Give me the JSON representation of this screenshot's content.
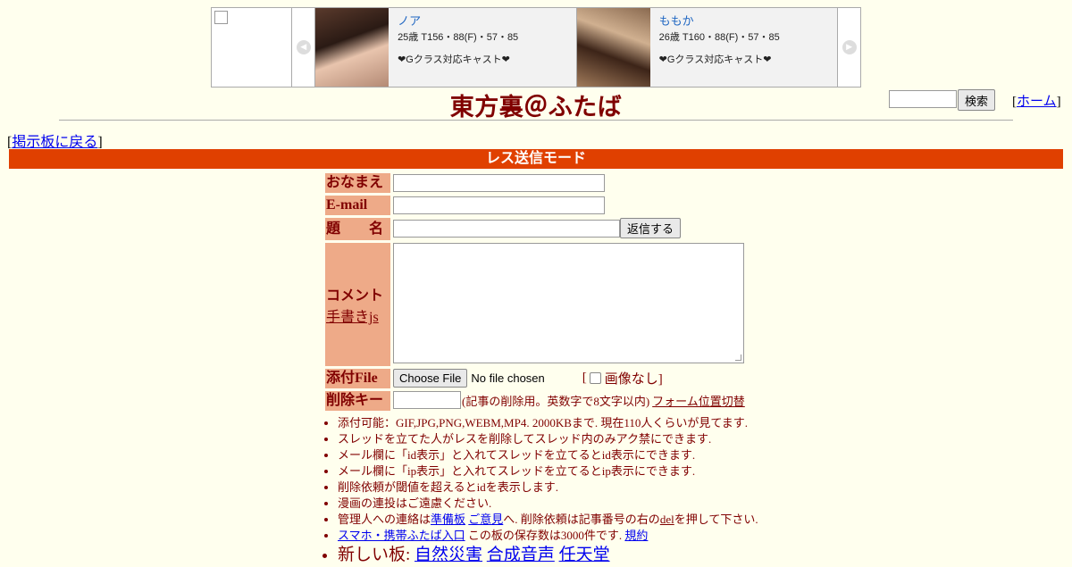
{
  "ad": {
    "casts": [
      {
        "name": "ノア",
        "stats": "25歳 T156・88(F)・57・85",
        "tag": "❤Gクラス対応キャスト❤"
      },
      {
        "name": "ももか",
        "stats": "26歳 T160・88(F)・57・85",
        "tag": "❤Gクラス対応キャスト❤"
      }
    ]
  },
  "header": {
    "title": "東方裏＠ふたば",
    "search_button": "検索",
    "home_open": "[",
    "home_label": "ホーム",
    "home_close": "]"
  },
  "nav": {
    "back_open": "[",
    "back_label": "掲示板に戻る",
    "back_close": "]"
  },
  "mode_title": "レス送信モード",
  "form": {
    "name_label": "おなまえ",
    "email_label": "E-mail",
    "subject_label": "題　　名",
    "submit_label": "返信する",
    "comment_label": "コメント",
    "handwrite_link": "手書きjs",
    "file_label": "添付File",
    "file_button": "Choose File",
    "file_status": "No file chosen",
    "noimage_open": "[",
    "noimage_label": "画像なし]",
    "delkey_label": "削除キー",
    "delkey_note": "(記事の削除用。英数字で8文字以内)",
    "form_toggle": "フォーム位置切替"
  },
  "rules": {
    "r1": "添付可能：GIF,JPG,PNG,WEBM,MP4. 2000KBまで. 現在110人くらいが見てます.",
    "r2": "スレッドを立てた人がレスを削除してスレッド内のみアク禁にできます.",
    "r3": "メール欄に「id表示」と入れてスレッドを立てるとid表示にできます.",
    "r4": "メール欄に「ip表示」と入れてスレッドを立てるとip表示にできます.",
    "r5": "削除依頼が閾値を超えるとidを表示します.",
    "r6": "漫画の連投はご遠慮ください.",
    "r7_a": "管理人への連絡は",
    "r7_link1": "準備板",
    "r7_link2": "ご意見",
    "r7_b": "へ. 削除依頼は記事番号の右の",
    "r7_del": "del",
    "r7_c": "を押して下さい.",
    "r8_link": "スマホ・携帯ふたば入口",
    "r8_text": "この板の保存数は3000件です.",
    "r8_rules": "規約",
    "r9_label": "新しい板:",
    "r9_b1": "自然災害",
    "r9_b2": "合成音声",
    "r9_b3": "任天堂"
  }
}
